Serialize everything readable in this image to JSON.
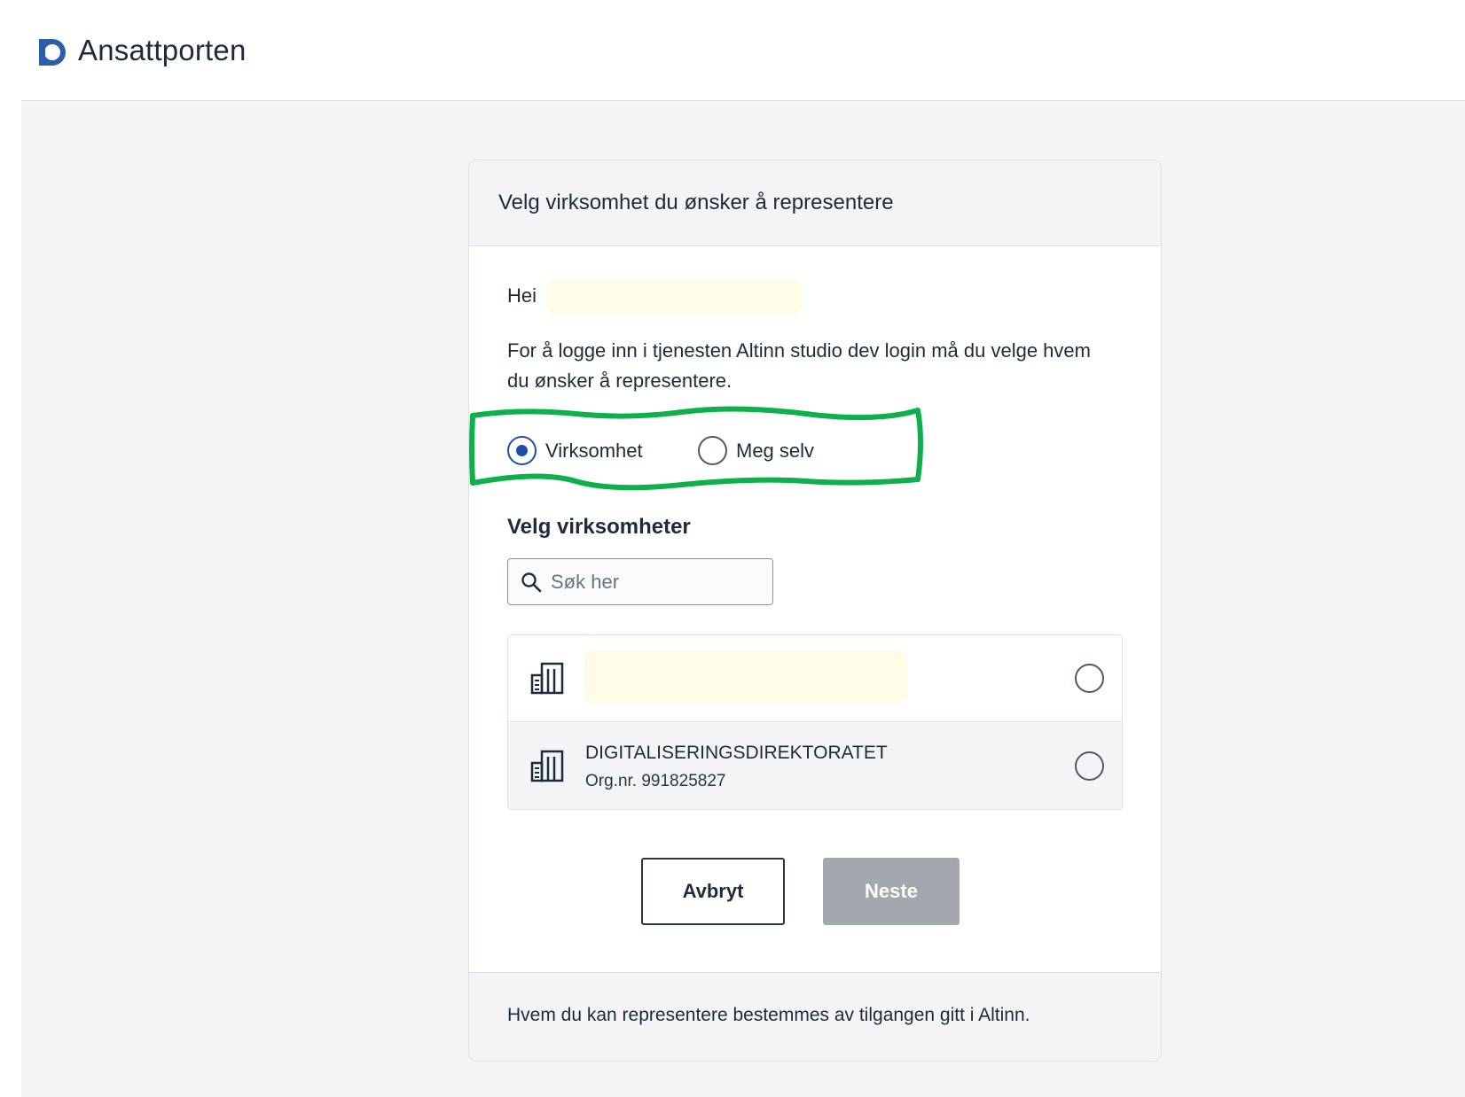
{
  "header": {
    "brand": "Ansattporten",
    "logo_icon": "d-logo-icon",
    "logo_color": "#2c5ea8"
  },
  "card": {
    "title": "Velg virksomhet du ønsker å representere",
    "greeting": "Hei",
    "intro": "For å logge inn i tjenesten Altinn studio dev login må du velge hvem du ønsker å representere.",
    "representation_options": [
      {
        "label": "Virksomhet",
        "checked": true
      },
      {
        "label": "Meg selv",
        "checked": false
      }
    ],
    "section_title": "Velg virksomheter",
    "search": {
      "placeholder": "Søk her",
      "value": "",
      "icon": "search-icon"
    },
    "organizations": [
      {
        "name": "",
        "org_nr": "",
        "selected": false,
        "icon": "building-icon"
      },
      {
        "name": "DIGITALISERINGSDIREKTORATET",
        "org_nr": "Org.nr. 991825827",
        "selected": false,
        "icon": "building-icon"
      }
    ],
    "buttons": {
      "cancel": "Avbryt",
      "next": "Neste"
    },
    "footer": "Hvem du kan representere bestemmes av tilgangen gitt i Altinn."
  },
  "colors": {
    "accent": "#1e4fa8",
    "annotation_highlight": "#0db04a",
    "redaction": "#fffbe6",
    "disabled_button": "#a4a8ae"
  }
}
